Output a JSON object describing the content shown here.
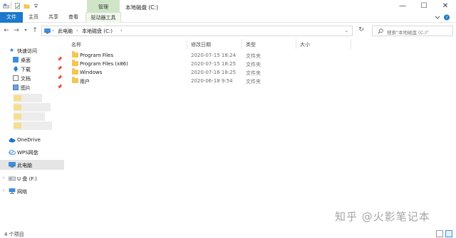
{
  "title_bar": {
    "context_tab": "管理",
    "window_title": "本地磁盘 (C:)",
    "minimize": "—",
    "maximize": "☐",
    "close": "✕"
  },
  "ribbon": {
    "tabs": [
      "文件",
      "主页",
      "共享",
      "查看",
      "驱动器工具"
    ]
  },
  "address": {
    "crumbs": [
      "此电脑",
      "本地磁盘 (C:)"
    ],
    "search_placeholder": "搜索\"本地磁盘 (C:)\""
  },
  "nav_pane": {
    "quick_access": "快速访问",
    "pinned": [
      "桌面",
      "下载",
      "文档",
      "图片"
    ],
    "onedrive": "OneDrive",
    "wps": "WPS网盘",
    "this_pc": "此电脑",
    "usb": "U 盘 (F:)",
    "network": "网络"
  },
  "columns": [
    "名称",
    "修改日期",
    "类型",
    "大小"
  ],
  "files": [
    {
      "name": "Program Files",
      "date": "2020-07-15 18:24",
      "type": "文件夹"
    },
    {
      "name": "Program Files (x86)",
      "date": "2020-07-15 18:25",
      "type": "文件夹"
    },
    {
      "name": "Windows",
      "date": "2020-07-16 18:25",
      "type": "文件夹"
    },
    {
      "name": "用户",
      "date": "2020-06-18 9:54",
      "type": "文件夹"
    }
  ],
  "status": {
    "item_count": "4 个项目"
  },
  "watermark": "知乎 @火影笔记本",
  "colors": {
    "accent": "#1979ca",
    "context_tab": "#cfe5c7",
    "folder": "#f4c64f",
    "selected_nav": "#e5e5e5"
  }
}
